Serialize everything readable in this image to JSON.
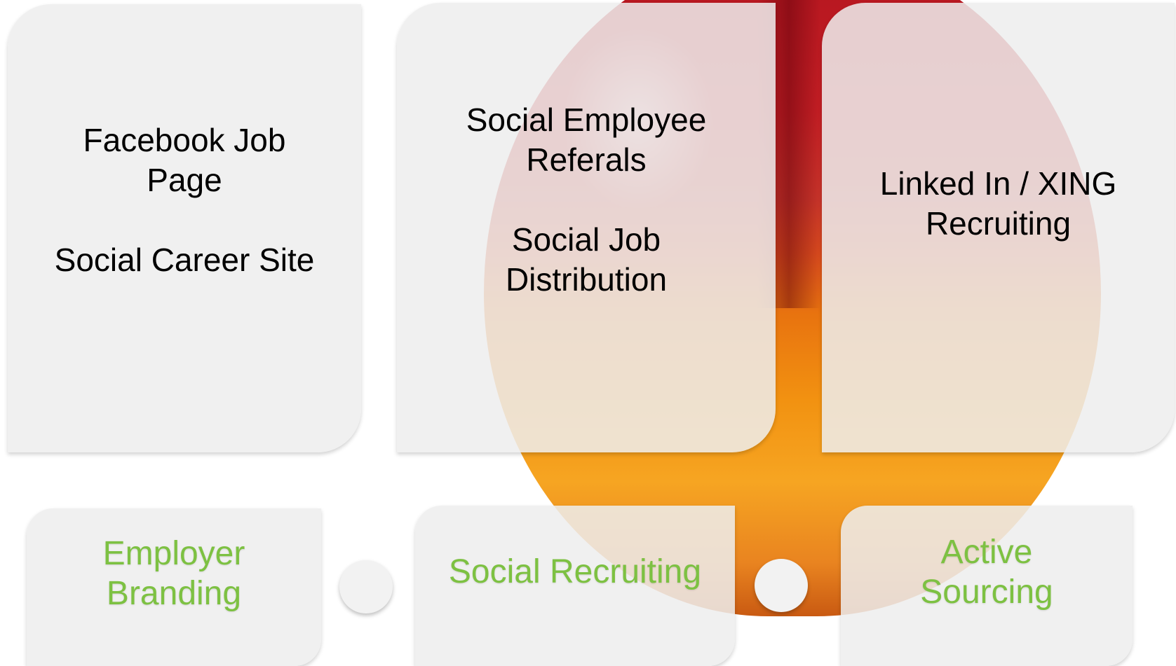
{
  "top_cards": [
    {
      "group1": [
        "Facebook Job",
        "Page"
      ],
      "group2": [
        "Social Career Site"
      ]
    },
    {
      "group1": [
        "Social Employee",
        "Referals"
      ],
      "group2": [
        "Social Job",
        "Distribution"
      ]
    },
    {
      "group1": [
        "Linked In / XING",
        "Recruiting"
      ]
    }
  ],
  "bottom_cards": [
    {
      "lines": [
        "Employer",
        "Branding"
      ]
    },
    {
      "lines": [
        "Social Recruiting"
      ]
    },
    {
      "lines": [
        "Active",
        "Sourcing"
      ]
    }
  ],
  "colors": {
    "card_background": "#eeeeee",
    "bottom_text": "#7dc142",
    "top_text": "#000000",
    "connector_dot": "#f2f2f2"
  }
}
